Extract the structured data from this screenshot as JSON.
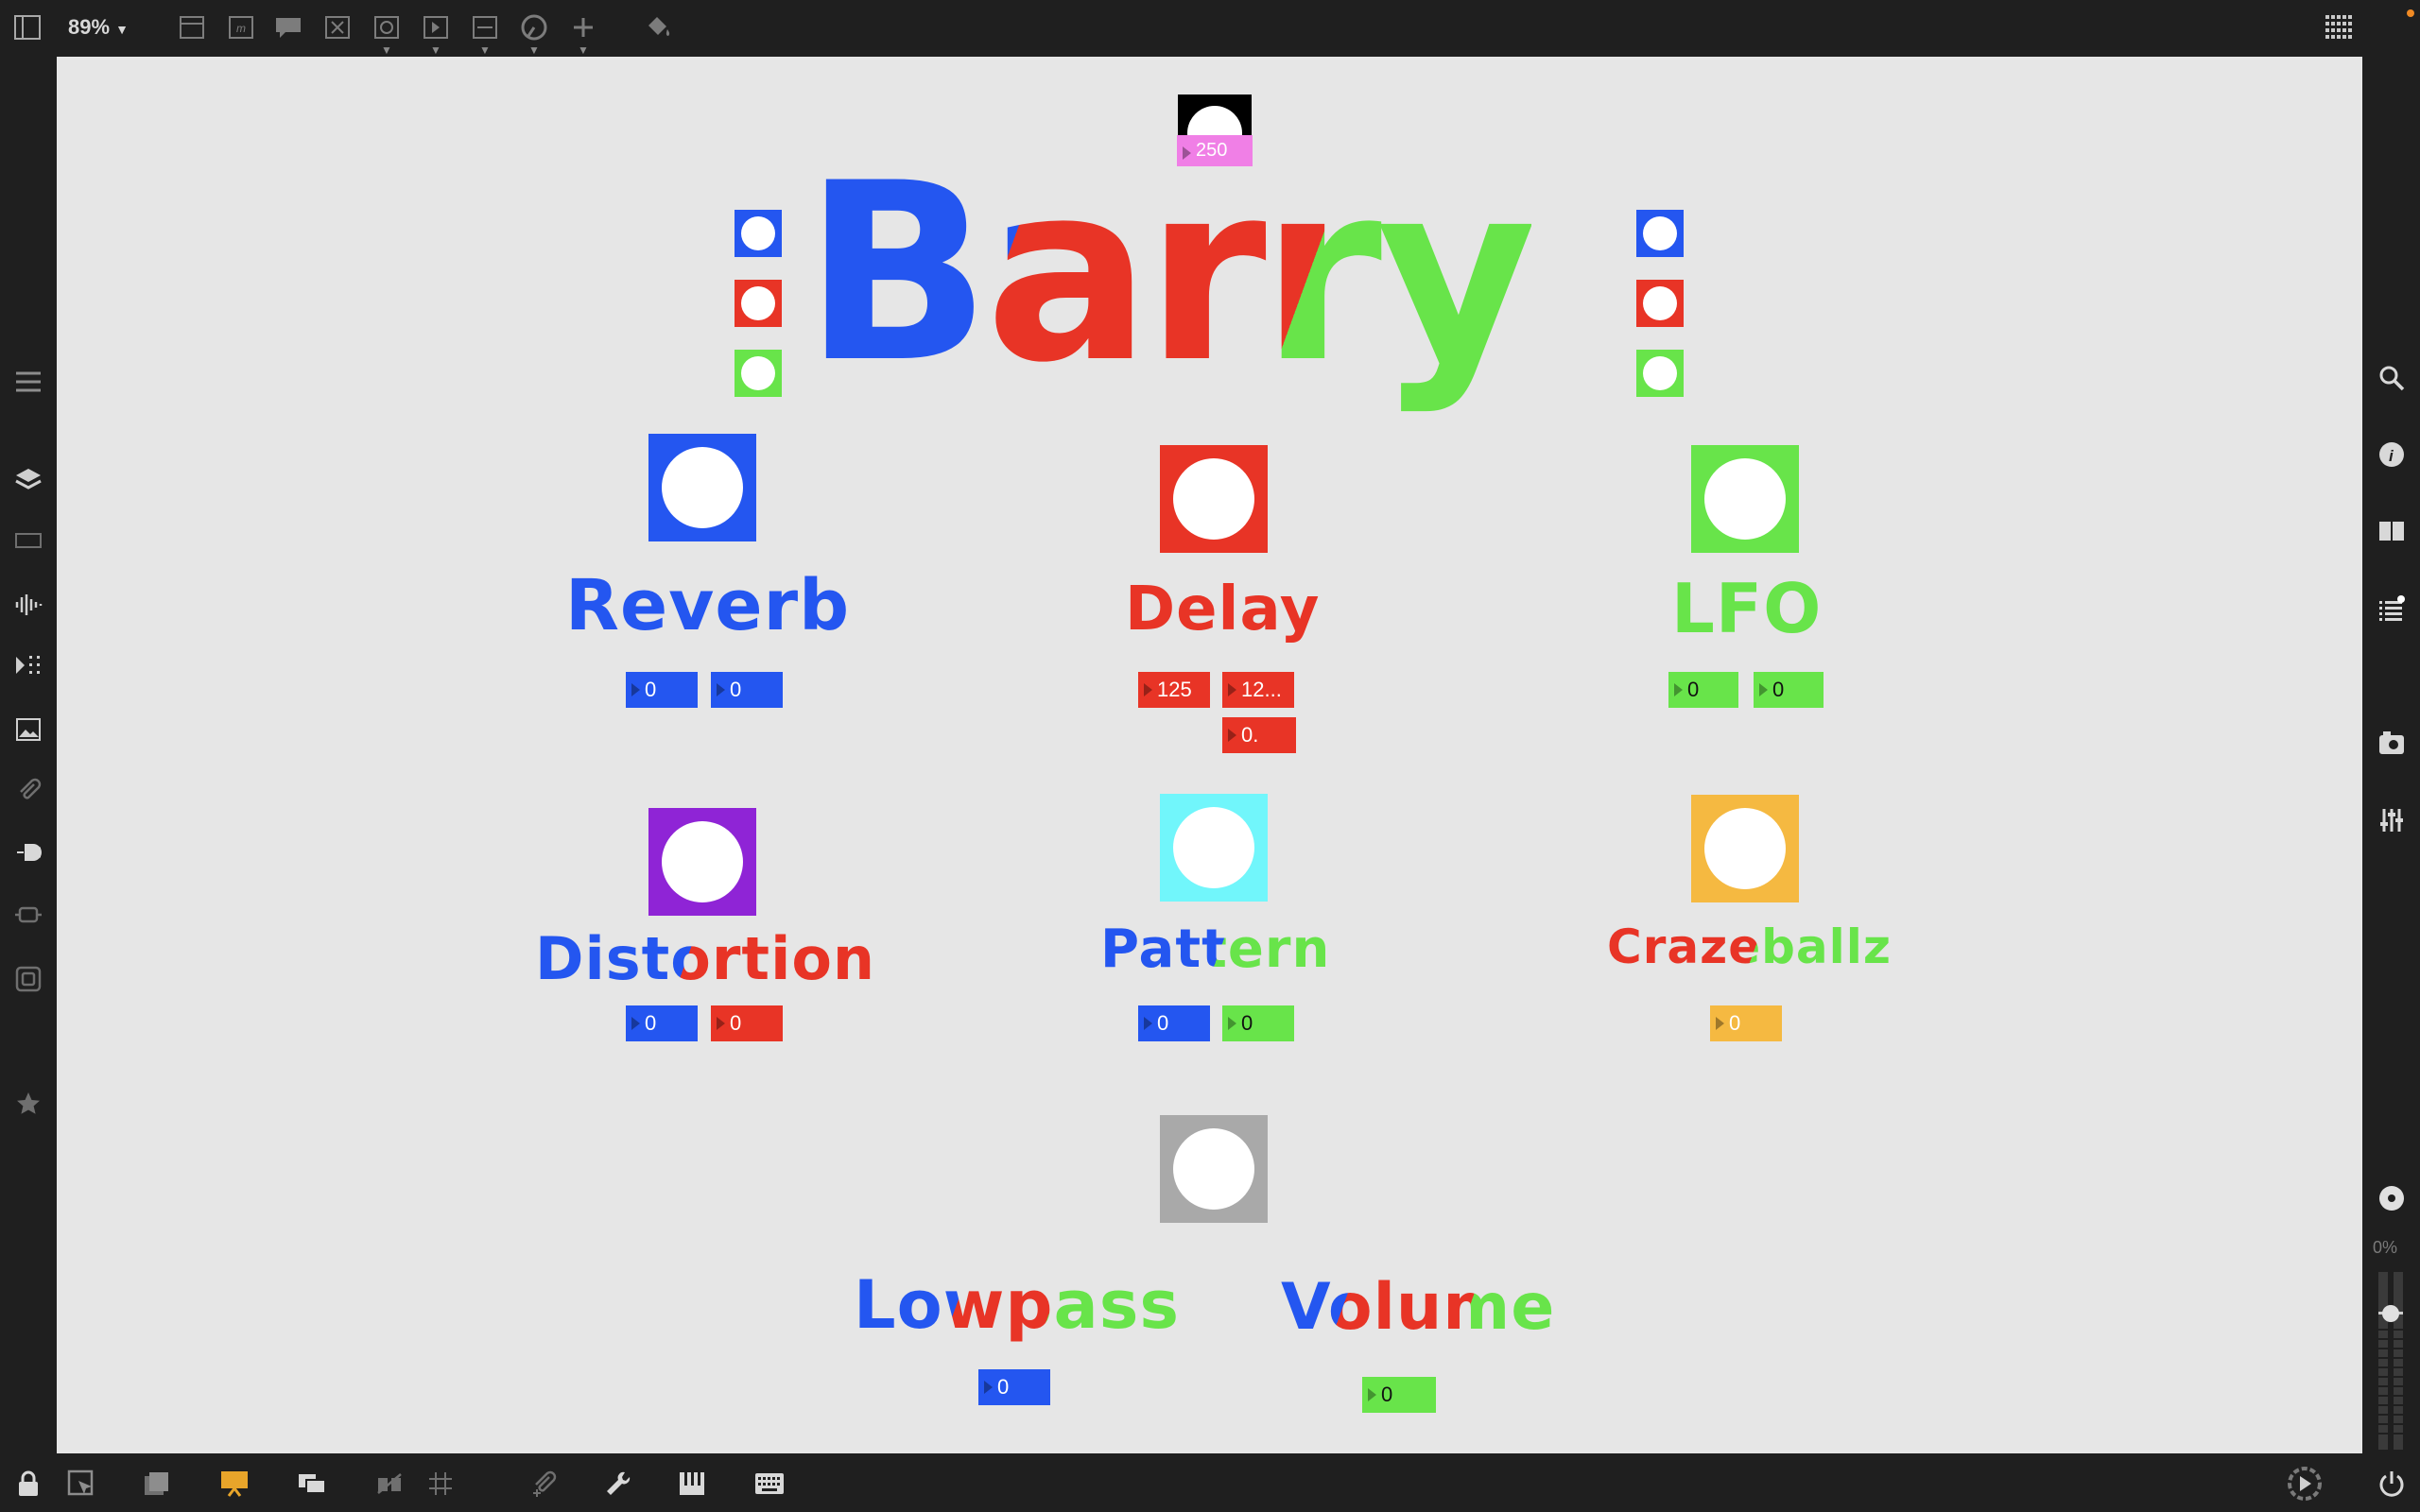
{
  "toolbar": {
    "zoom": "89%",
    "zoom_caret": "▼"
  },
  "meter": {
    "percent": "0%"
  },
  "patch": {
    "title": "Barry",
    "top_number": "250",
    "modules": [
      {
        "name": "Reverb",
        "values": [
          "0",
          "0"
        ]
      },
      {
        "name": "Delay",
        "values": [
          "125",
          "12...",
          "0."
        ]
      },
      {
        "name": "LFO",
        "values": [
          "0",
          "0"
        ]
      },
      {
        "name": "Distortion",
        "values": [
          "0",
          "0"
        ]
      },
      {
        "name": "Pattern",
        "values": [
          "0",
          "0"
        ]
      },
      {
        "name": "Crazeballz",
        "values": [
          "0"
        ]
      },
      {
        "name": "Lowpass",
        "values": [
          "0"
        ]
      },
      {
        "name": "Volume",
        "values": [
          "0"
        ]
      }
    ]
  },
  "colors": {
    "blue": "#2456f0",
    "red": "#e83426",
    "green": "#68e44a",
    "purple": "#8f24d6",
    "cyan": "#71f6fb",
    "orange": "#f5b941",
    "gray": "#a9a9a9",
    "pink": "#f07fe6",
    "canvas": "#e6e6e6",
    "chrome": "#1f1f1f"
  }
}
